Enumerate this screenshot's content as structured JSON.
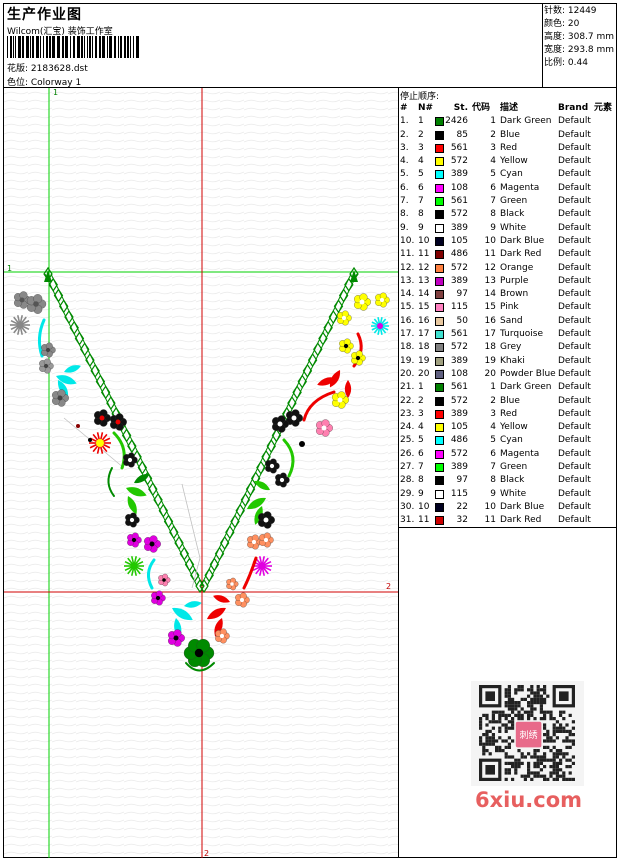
{
  "header": {
    "title": "生产作业图",
    "subtitle": "Wilcom(汇宝) 装饰工作室",
    "file_label": "花版: 2183628.dst",
    "colorway_label": "色位: Colorway 1"
  },
  "stats": {
    "stitches": "针数: 12449",
    "colors": "颜色: 20",
    "height": "高度: 308.7 mm",
    "width": "宽度: 293.8 mm",
    "scale": "比例: 0.44"
  },
  "stop_sequence_label": "停止顺序:",
  "table": {
    "headers": [
      "#",
      "N#",
      "St.",
      "代码",
      "描述",
      "Brand",
      "元素"
    ],
    "rows": [
      {
        "idx": "1.",
        "n": "1",
        "color": "#008000",
        "st": "2426",
        "code": "1",
        "desc": "Dark Green",
        "brand": "Default"
      },
      {
        "idx": "2.",
        "n": "2",
        "color": "#000000",
        "st": "85",
        "code": "2",
        "desc": "Blue",
        "brand": "Default"
      },
      {
        "idx": "3.",
        "n": "3",
        "color": "#ff0000",
        "st": "561",
        "code": "3",
        "desc": "Red",
        "brand": "Default"
      },
      {
        "idx": "4.",
        "n": "4",
        "color": "#ffff00",
        "st": "572",
        "code": "4",
        "desc": "Yellow",
        "brand": "Default"
      },
      {
        "idx": "5.",
        "n": "5",
        "color": "#00ffff",
        "st": "389",
        "code": "5",
        "desc": "Cyan",
        "brand": "Default"
      },
      {
        "idx": "6.",
        "n": "6",
        "color": "#ff00ff",
        "st": "108",
        "code": "6",
        "desc": "Magenta",
        "brand": "Default"
      },
      {
        "idx": "7.",
        "n": "7",
        "color": "#00ff00",
        "st": "561",
        "code": "7",
        "desc": "Green",
        "brand": "Default"
      },
      {
        "idx": "8.",
        "n": "8",
        "color": "#000000",
        "st": "572",
        "code": "8",
        "desc": "Black",
        "brand": "Default"
      },
      {
        "idx": "9.",
        "n": "9",
        "color": "#ffffff",
        "st": "389",
        "code": "9",
        "desc": "White",
        "brand": "Default"
      },
      {
        "idx": "10.",
        "n": "10",
        "color": "#000020",
        "st": "105",
        "code": "10",
        "desc": "Dark Blue",
        "brand": "Default"
      },
      {
        "idx": "11.",
        "n": "11",
        "color": "#800000",
        "st": "486",
        "code": "11",
        "desc": "Dark Red",
        "brand": "Default"
      },
      {
        "idx": "12.",
        "n": "12",
        "color": "#ff8040",
        "st": "572",
        "code": "12",
        "desc": "Orange",
        "brand": "Default"
      },
      {
        "idx": "13.",
        "n": "13",
        "color": "#c000c0",
        "st": "389",
        "code": "13",
        "desc": "Purple",
        "brand": "Default"
      },
      {
        "idx": "14.",
        "n": "14",
        "color": "#804040",
        "st": "97",
        "code": "14",
        "desc": "Brown",
        "brand": "Default"
      },
      {
        "idx": "15.",
        "n": "15",
        "color": "#ff80c0",
        "st": "115",
        "code": "15",
        "desc": "Pink",
        "brand": "Default"
      },
      {
        "idx": "16.",
        "n": "16",
        "color": "#e8c8a0",
        "st": "50",
        "code": "16",
        "desc": "Sand",
        "brand": "Default"
      },
      {
        "idx": "17.",
        "n": "17",
        "color": "#40e0d0",
        "st": "561",
        "code": "17",
        "desc": "Turquoise",
        "brand": "Default"
      },
      {
        "idx": "18.",
        "n": "18",
        "color": "#808080",
        "st": "572",
        "code": "18",
        "desc": "Grey",
        "brand": "Default"
      },
      {
        "idx": "19.",
        "n": "19",
        "color": "#a0a080",
        "st": "389",
        "code": "19",
        "desc": "Khaki",
        "brand": "Default"
      },
      {
        "idx": "20.",
        "n": "20",
        "color": "#606080",
        "st": "108",
        "code": "20",
        "desc": "Powder Blue",
        "brand": "Default"
      },
      {
        "idx": "21.",
        "n": "1",
        "color": "#008000",
        "st": "561",
        "code": "1",
        "desc": "Dark Green",
        "brand": "Default"
      },
      {
        "idx": "22.",
        "n": "2",
        "color": "#000000",
        "st": "572",
        "code": "2",
        "desc": "Blue",
        "brand": "Default"
      },
      {
        "idx": "23.",
        "n": "3",
        "color": "#ff0000",
        "st": "389",
        "code": "3",
        "desc": "Red",
        "brand": "Default"
      },
      {
        "idx": "24.",
        "n": "4",
        "color": "#ffff00",
        "st": "105",
        "code": "4",
        "desc": "Yellow",
        "brand": "Default"
      },
      {
        "idx": "25.",
        "n": "5",
        "color": "#00ffff",
        "st": "486",
        "code": "5",
        "desc": "Cyan",
        "brand": "Default"
      },
      {
        "idx": "26.",
        "n": "6",
        "color": "#ff00ff",
        "st": "572",
        "code": "6",
        "desc": "Magenta",
        "brand": "Default"
      },
      {
        "idx": "27.",
        "n": "7",
        "color": "#00ff00",
        "st": "389",
        "code": "7",
        "desc": "Green",
        "brand": "Default"
      },
      {
        "idx": "28.",
        "n": "8",
        "color": "#000000",
        "st": "97",
        "code": "8",
        "desc": "Black",
        "brand": "Default"
      },
      {
        "idx": "29.",
        "n": "9",
        "color": "#ffffff",
        "st": "115",
        "code": "9",
        "desc": "White",
        "brand": "Default"
      },
      {
        "idx": "30.",
        "n": "10",
        "color": "#000020",
        "st": "22",
        "code": "10",
        "desc": "Dark Blue",
        "brand": "Default"
      },
      {
        "idx": "31.",
        "n": "11",
        "color": "#cc0000",
        "st": "32",
        "code": "11",
        "desc": "Dark Red",
        "brand": "Default"
      }
    ]
  },
  "guides": {
    "h_label_left": "1",
    "h_label_right": "2",
    "v_label_top": "1",
    "v_label_bottom": "2"
  },
  "watermark": "6xiu.com",
  "qr_center_text": "刺绣"
}
